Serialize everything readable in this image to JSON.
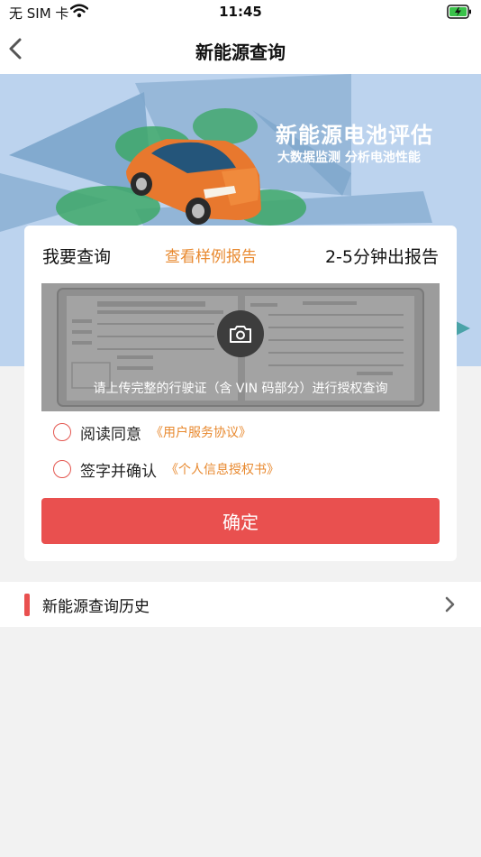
{
  "status_bar": {
    "carrier": "无 SIM 卡",
    "time": "11:45"
  },
  "nav": {
    "title": "新能源查询"
  },
  "banner": {
    "title": "新能源电池评估",
    "subtitle": "大数据监测 分析电池性能"
  },
  "query_card": {
    "heading": "我要查询",
    "sample_link": "查看样例报告",
    "turnaround": "2-5分钟出报告",
    "upload_hint": "请上传完整的行驶证（含 VIN 码部分）进行授权查询",
    "agreements": [
      {
        "label": "阅读同意",
        "link": "《用户服务协议》"
      },
      {
        "label": "签字并确认",
        "link": "《个人信息授权书》"
      }
    ],
    "confirm_label": "确定"
  },
  "history": {
    "label": "新能源查询历史"
  },
  "colors": {
    "accent_red": "#e9504f",
    "link_orange": "#e8892f",
    "banner_bg": "#bcd3ee",
    "car_orange": "#e8782e"
  },
  "icons": [
    "wifi-icon",
    "battery-charging-icon",
    "back-chevron-icon",
    "camera-icon",
    "chevron-right-icon"
  ]
}
